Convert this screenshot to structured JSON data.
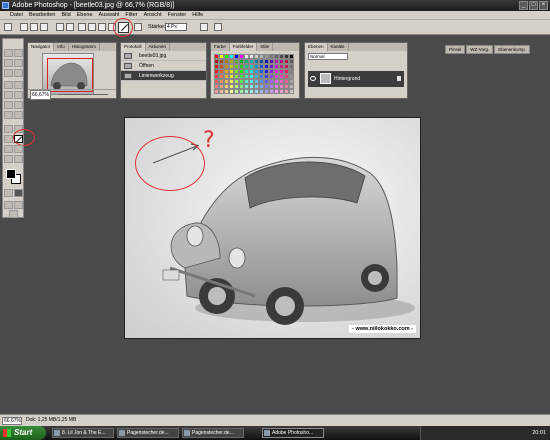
{
  "window": {
    "title": "Adobe Photoshop - [beetle03.jpg @ 66,7% (RGB/8)]"
  },
  "menu": [
    "Datei",
    "Bearbeiten",
    "Bild",
    "Ebene",
    "Auswahl",
    "Filter",
    "Ansicht",
    "Fenster",
    "Hilfe"
  ],
  "options": {
    "weight_label": "Stärke:",
    "weight_value": "4 Px"
  },
  "well_tabs": [
    "Pinsel",
    "WZ-Vorg.",
    "Ebenenkomp."
  ],
  "navigator": {
    "tabs": [
      "Navigator",
      "Info",
      "Histogramm"
    ],
    "zoom": "66,67%"
  },
  "history": {
    "tabs": [
      "Protokoll",
      "Aktionen"
    ],
    "snapshot": "beetle03.jpg",
    "items": [
      "Öffnen",
      "Linienwerkzeug"
    ]
  },
  "color_panel": {
    "tabs": [
      "Farbe",
      "Farbfelder",
      "Stile"
    ],
    "swatch_colors": [
      "#ff0000",
      "#ffff00",
      "#00ff00",
      "#00ffff",
      "#0000ff",
      "#ff00ff",
      "#ffffff",
      "#e6e6e6",
      "#cccccc",
      "#b3b3b3",
      "#999999",
      "#808080",
      "#666666",
      "#4d4d4d",
      "#333333",
      "#000000"
    ]
  },
  "layers": {
    "tabs": [
      "Ebenen",
      "Kanäle"
    ],
    "mode": "Normal",
    "layer_name": "Hintergrund"
  },
  "canvas": {
    "annotation": "?",
    "credit": "- www.niilokokko.com -"
  },
  "status": {
    "zoom": "66,67%",
    "doc": "Dok: 1,25 MB/1,25 MB"
  },
  "taskbar": {
    "start": "Start",
    "items": [
      "8. Lil Jon & The E...",
      "Pagenstecher.de...",
      "Pagenstecher.de...",
      "Adobe Photosho..."
    ],
    "clock": "20:01"
  }
}
